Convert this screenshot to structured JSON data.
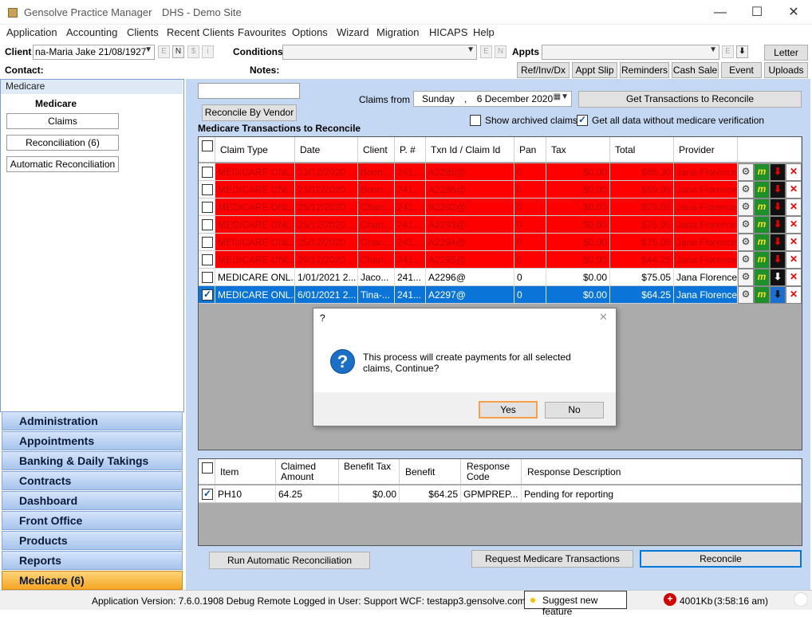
{
  "window": {
    "app_title": "Gensolve Practice Manager",
    "site": "DHS - Demo Site",
    "min": "—",
    "max": "☐",
    "close": "✕"
  },
  "menu": [
    "Application",
    "Accounting",
    "Clients",
    "Recent Clients",
    "Favourites",
    "Options",
    "Wizard",
    "Migration",
    "HICAPS",
    "Help"
  ],
  "toolbar": {
    "client_label": "Client",
    "client_value": "na-Maria Jake 21/08/1927",
    "client_btns": [
      "E",
      "N",
      "$",
      "i"
    ],
    "conditions_label": "Conditions",
    "cond_btns": [
      "E",
      "N"
    ],
    "appts_label": "Appts",
    "appt_btns": [
      "E",
      "⬇"
    ],
    "letter": "Letter",
    "contact_label": "Contact:",
    "notes_label": "Notes:",
    "buttons": [
      "Ref/Inv/Dx",
      "Appt Slip",
      "Reminders",
      "Cash Sale",
      "Event",
      "Uploads"
    ]
  },
  "left": {
    "header": "Medicare",
    "section": "Medicare",
    "buttons": [
      "Claims",
      "Reconciliation (6)",
      "Automatic Reconciliation"
    ],
    "nav": [
      "Administration",
      "Appointments",
      "Banking & Daily Takings",
      "Contracts",
      "Dashboard",
      "Front Office",
      "Products",
      "Reports",
      "Medicare (6)"
    ]
  },
  "main": {
    "search_value": "",
    "reconcile_vendor": "Reconcile By Vendor",
    "claims_from_label": "Claims from :",
    "date_day": "Sunday",
    "date_sep": ",",
    "date_value": "6 December 2020",
    "get_tx": "Get Transactions to Reconcile",
    "section_title": "Medicare Transactions to Reconcile",
    "show_archived": "Show archived claims",
    "get_all": "Get all data without medicare verification",
    "run_auto": "Run Automatic Reconciliation",
    "request_tx": "Request Medicare Transactions",
    "reconcile": "Reconcile"
  },
  "grid": {
    "headers": [
      "Claim Type",
      "Date",
      "Client",
      "P. #",
      "Txn Id / Claim Id",
      "Pan",
      "Tax",
      "Total",
      "Provider"
    ],
    "rows": [
      {
        "style": "red",
        "checked": false,
        "claim": "MEDICARE ONL...",
        "date": "23/12/2020 ...",
        "client": "Boon...",
        "p": "241...",
        "txn": "A2285@",
        "pan": "0",
        "tax": "$0.00",
        "total": "$65.30",
        "provider": "Jana Florence"
      },
      {
        "style": "red",
        "checked": false,
        "claim": "MEDICARE ONL...",
        "date": "23/12/2020 ...",
        "client": "Boon...",
        "p": "241...",
        "txn": "A2286@",
        "pan": "0",
        "tax": "$0.00",
        "total": "$69.05",
        "provider": "Jana Florence"
      },
      {
        "style": "red",
        "checked": false,
        "claim": "MEDICARE ONL...",
        "date": "25/12/2020 ...",
        "client": "Chan...",
        "p": "241...",
        "txn": "A2292@",
        "pan": "0",
        "tax": "$0.00",
        "total": "$75.05",
        "provider": "Jana Florence"
      },
      {
        "style": "red",
        "checked": false,
        "claim": "MEDICARE ONL...",
        "date": "25/12/2020 ...",
        "client": "Chan...",
        "p": "241...",
        "txn": "A2293@",
        "pan": "0",
        "tax": "$0.00",
        "total": "$75.05",
        "provider": "Jana Florence"
      },
      {
        "style": "red",
        "checked": false,
        "claim": "MEDICARE ONL...",
        "date": "25/12/2020 ...",
        "client": "Chan...",
        "p": "241...",
        "txn": "A2294@",
        "pan": "0",
        "tax": "$0.00",
        "total": "$75.05",
        "provider": "Jana Florence"
      },
      {
        "style": "red",
        "checked": false,
        "claim": "MEDICARE ONL...",
        "date": "29/12/2020 ...",
        "client": "Chan...",
        "p": "241...",
        "txn": "A2295@",
        "pan": "0",
        "tax": "$0.00",
        "total": "$44.25",
        "provider": "Jana Florence"
      },
      {
        "style": "white",
        "checked": false,
        "claim": "MEDICARE ONL...",
        "date": "1/01/2021 2...",
        "client": "Jaco...",
        "p": "241...",
        "txn": "A2296@",
        "pan": "0",
        "tax": "$0.00",
        "total": "$75.05",
        "provider": "Jana Florence"
      },
      {
        "style": "sel",
        "checked": true,
        "claim": "MEDICARE ONL...",
        "date": "6/01/2021 2...",
        "client": "Tina-...",
        "p": "241...",
        "txn": "A2297@",
        "pan": "0",
        "tax": "$0.00",
        "total": "$64.25",
        "provider": "Jana Florence"
      }
    ]
  },
  "grid2": {
    "headers": [
      "Item",
      "Claimed Amount",
      "Benefit Tax",
      "Benefit",
      "Response Code",
      "Response Description"
    ],
    "row": {
      "item": "PH10",
      "claimed": "64.25",
      "tax": "$0.00",
      "benefit": "$64.25",
      "code": "GPMPREP...",
      "desc": "Pending for reporting"
    }
  },
  "dialog": {
    "title": "?",
    "close": "✕",
    "message": "This process will create payments for all selected claims, Continue?",
    "yes": "Yes",
    "no": "No"
  },
  "status": {
    "version": "Application Version: 7.6.0.1908 Debug Remote  Logged in User: Support WCF: testapp3.gensolve.com:29191",
    "suggest": "Suggest new feature",
    "mem": "4001Kb",
    "time": "(3:58:16 am)"
  }
}
